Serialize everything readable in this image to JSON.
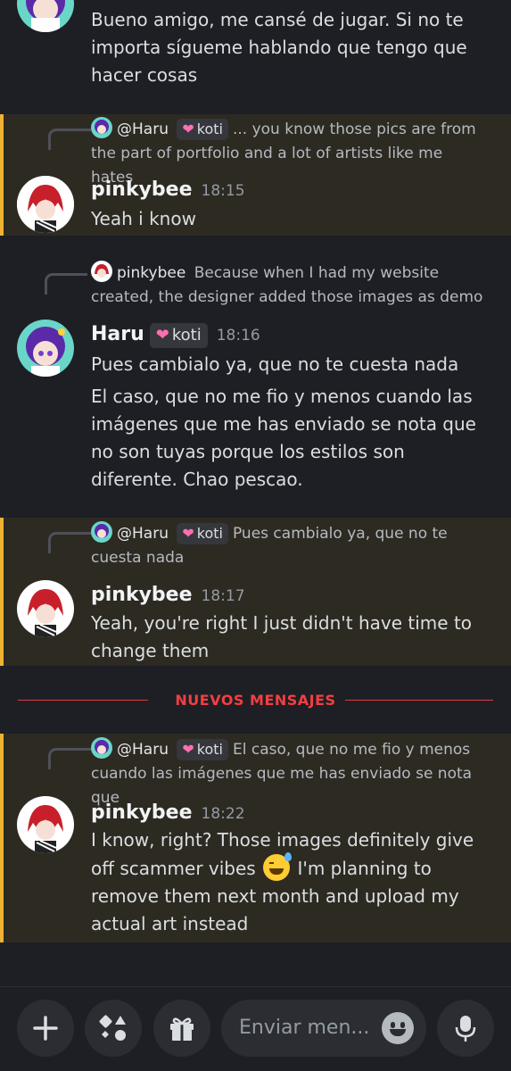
{
  "messages": [
    {
      "id": "m0",
      "lines": [
        "Bueno amigo, me cansé de jugar. Si no te importa sígueme hablando que tengo que hacer cosas"
      ]
    },
    {
      "id": "m1",
      "reply": {
        "author": "@Haru",
        "tag": "koti",
        "text": "... you know those pics are from the part of portfolio and a lot of artists like me hates"
      },
      "author": "pinkybee",
      "time": "18:15",
      "lines": [
        "Yeah i know"
      ],
      "highlight": true
    },
    {
      "id": "m2",
      "reply": {
        "author": "pinkybee",
        "text": "Because when I had my website created, the designer added those images as demo"
      },
      "author": "Haru",
      "tag": "koti",
      "time": "18:16",
      "lines": [
        "Pues cambialo ya, que no te cuesta nada",
        "El caso, que no me fio y menos cuando las imágenes que me has enviado se nota que no son tuyas porque los estilos son diferente. Chao pescao."
      ]
    },
    {
      "id": "m3",
      "reply": {
        "author": "@Haru",
        "tag": "koti",
        "text": "Pues cambialo ya, que no te cuesta nada"
      },
      "author": "pinkybee",
      "time": "18:17",
      "lines": [
        "Yeah, you're right  I just didn't have time to change them"
      ],
      "highlight": true
    },
    {
      "id": "m4",
      "reply": {
        "author": "@Haru",
        "tag": "koti",
        "text": "El caso, que no me fio y menos cuando las imágenes que me has enviado se nota que"
      },
      "author": "pinkybee",
      "time": "18:22",
      "body_before_emoji": "I know, right? Those images definitely give off scammer vibes",
      "emoji": "sweat-smile-emoji",
      "body_after_emoji": "I'm planning to remove them next month and upload my actual art instead",
      "highlight": true
    }
  ],
  "divider": {
    "label": "NUEVOS MENSAJES",
    "color": "#f23f43"
  },
  "composer": {
    "placeholder": "Enviar men...",
    "buttons": [
      "plus-icon",
      "apps-icon",
      "gift-icon",
      "emoji-icon",
      "microphone-icon"
    ]
  },
  "colors": {
    "highlight_bar": "#f0b232",
    "background": "#1e1f24",
    "highlight_bg": "#2d2a22"
  }
}
